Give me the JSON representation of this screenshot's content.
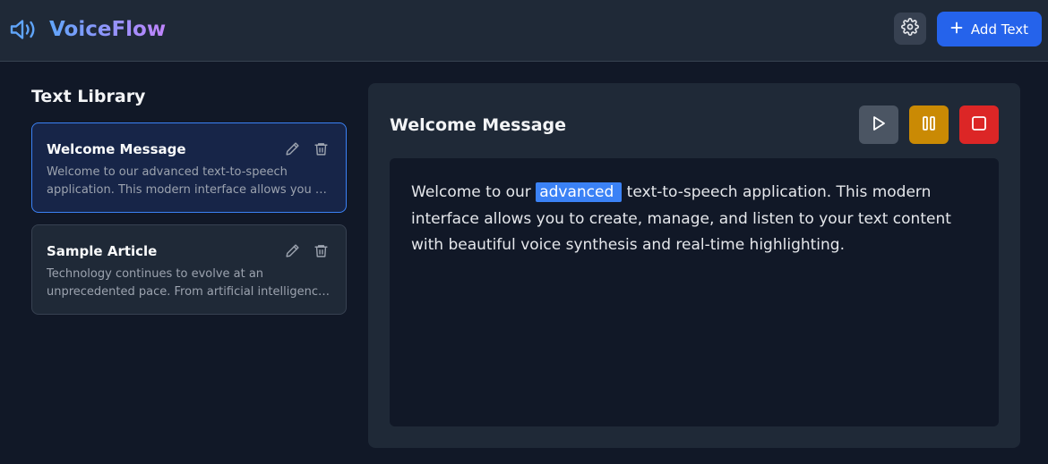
{
  "header": {
    "app_name": "VoiceFlow",
    "logo_icon": "speaker-volume-icon",
    "settings_icon": "gear-icon",
    "add_button_label": "Add Text",
    "add_icon": "plus-icon"
  },
  "sidebar": {
    "title": "Text Library",
    "items": [
      {
        "title": "Welcome Message",
        "preview_line1": "Welcome to our advanced text-to-speech",
        "preview_line2": "application. This modern interface allows you to create, manage, and listen",
        "active": true
      },
      {
        "title": "Sample Article",
        "preview_line1": "Technology continues to evolve at an",
        "preview_line2": "unprecedented pace. From artificial intelligence to quantum computing",
        "active": false
      }
    ]
  },
  "main": {
    "title": "Welcome Message",
    "controls": [
      "play-icon",
      "pause-icon",
      "stop-icon"
    ],
    "text_before": "Welcome to our ",
    "text_highlight": "advanced",
    "text_after": " text-to-speech application. This modern interface allows you to create, manage, and listen to your text content with beautiful voice synthesis and real-time highlighting."
  },
  "colors": {
    "background": "#111827",
    "surface": "#1f2937",
    "primary": "#2563eb",
    "highlight": "#3b82f6",
    "pause": "#ca8a04",
    "stop": "#dc2626",
    "play": "#4b5563"
  }
}
